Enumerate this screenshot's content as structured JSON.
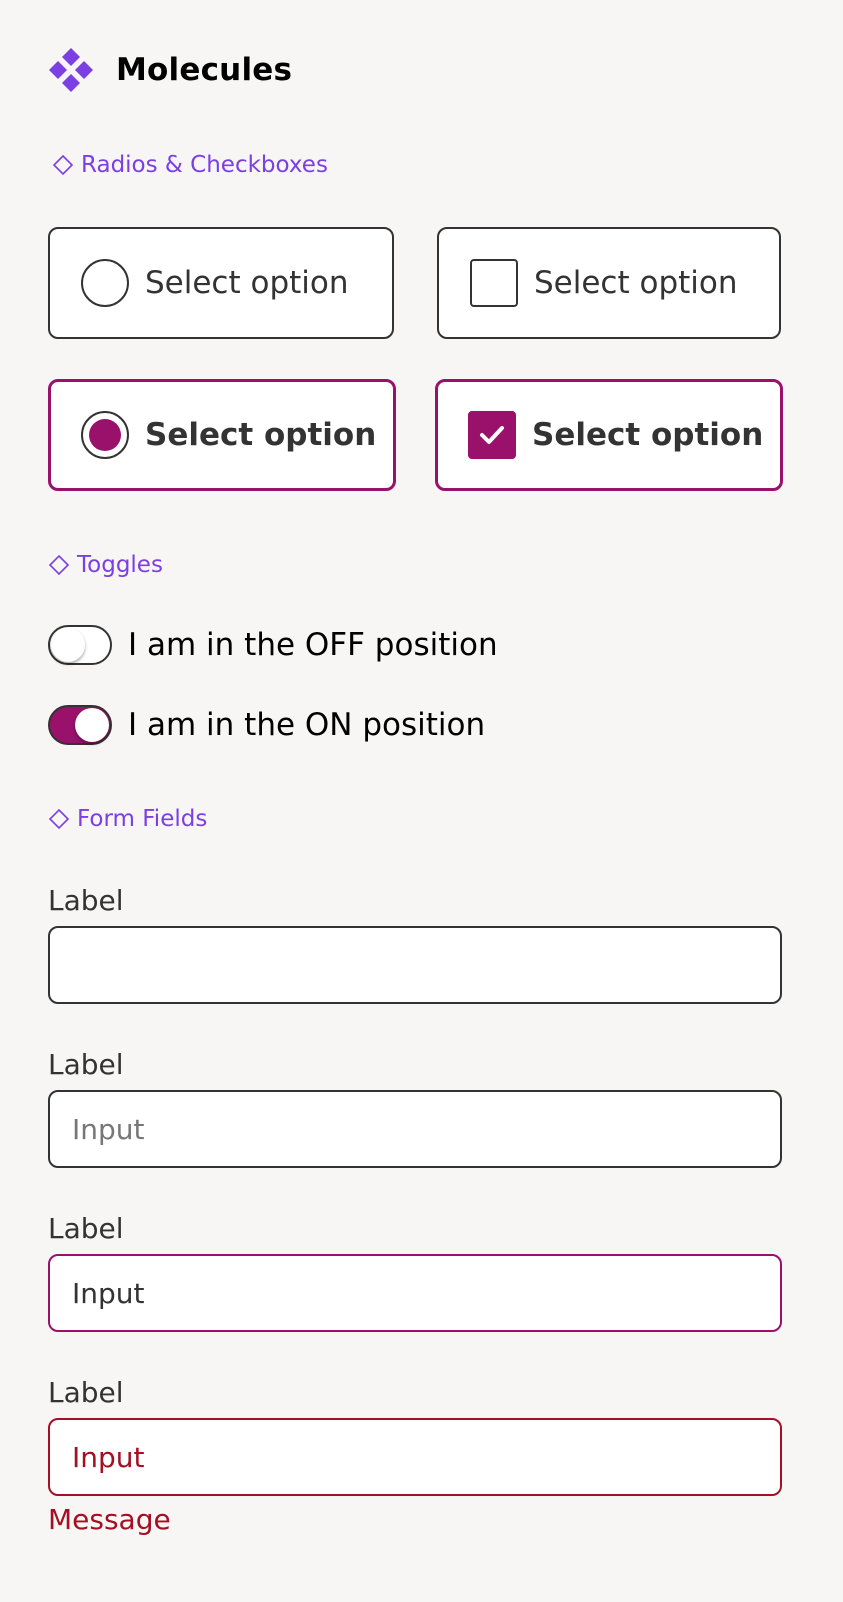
{
  "header": {
    "title": "Molecules",
    "logo_icon": "molecule-diamond-grid-icon"
  },
  "colors": {
    "accent_purple": "#7b3fe4",
    "brand_magenta": "#99116b",
    "error_red": "#a40f24",
    "border_dark": "#333333",
    "background": "#f7f6f5"
  },
  "sections": {
    "radios_checkboxes": {
      "heading": "Radios & Checkboxes",
      "icon": "diamond-outline-icon",
      "options": [
        {
          "type": "radio",
          "label": "Select option",
          "selected": false
        },
        {
          "type": "checkbox",
          "label": "Select option",
          "selected": false
        },
        {
          "type": "radio",
          "label": "Select option",
          "selected": true
        },
        {
          "type": "checkbox",
          "label": "Select option",
          "selected": true
        }
      ]
    },
    "toggles": {
      "heading": "Toggles",
      "icon": "diamond-outline-icon",
      "items": [
        {
          "label": "I am in the OFF position",
          "on": false
        },
        {
          "label": "I am in the ON position",
          "on": true
        }
      ]
    },
    "form_fields": {
      "heading": "Form Fields",
      "icon": "diamond-outline-icon",
      "fields": [
        {
          "label": "Label",
          "value": "",
          "placeholder": "",
          "state": "default"
        },
        {
          "label": "Label",
          "value": "",
          "placeholder": "Input",
          "state": "placeholder"
        },
        {
          "label": "Label",
          "value": "Input",
          "placeholder": "",
          "state": "focused"
        },
        {
          "label": "Label",
          "value": "Input",
          "placeholder": "",
          "state": "error",
          "message": "Message"
        }
      ]
    }
  }
}
